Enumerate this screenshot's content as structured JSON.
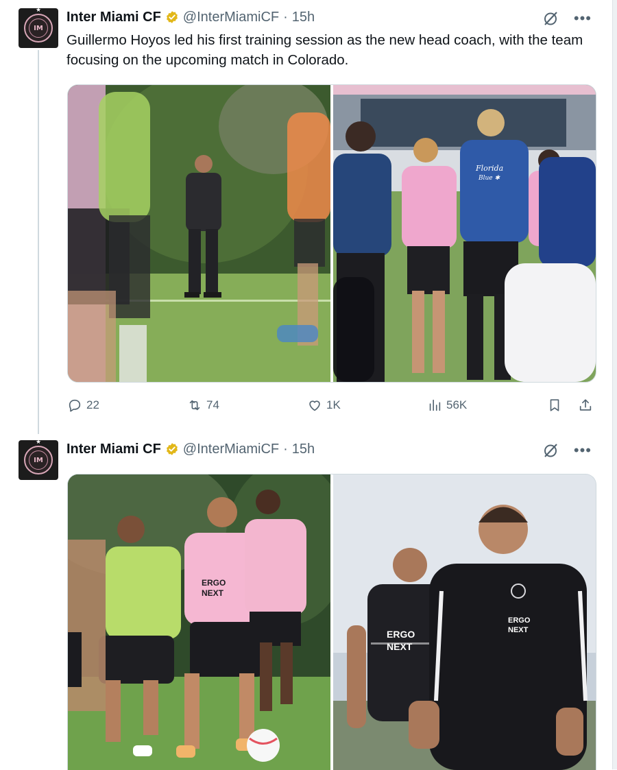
{
  "tweets": [
    {
      "author_name": "Inter Miami CF",
      "handle": "@InterMiamiCF",
      "separator": "·",
      "time": "15h",
      "text": "Guillermo Hoyos led his first training session as the new head coach, with the team focusing on the upcoming match in Colorado.",
      "photos": [
        {
          "subject": "coach-standing-on-training-field",
          "kit_text": ""
        },
        {
          "subject": "players-in-huddle-from-behind",
          "kit_text": "Florida Blue"
        }
      ],
      "stats": {
        "replies": "22",
        "reposts": "74",
        "likes": "1K",
        "views": "56K"
      }
    },
    {
      "author_name": "Inter Miami CF",
      "handle": "@InterMiamiCF",
      "separator": "·",
      "time": "15h",
      "photos": [
        {
          "subject": "players-training-with-ball",
          "kit_text": "ERGO NEXT"
        },
        {
          "subject": "coach-walking-with-player",
          "kit_text": "ERGO NEXT"
        }
      ]
    }
  ],
  "colors": {
    "verified_gold": "#e2b719",
    "text": "#0f1419",
    "secondary": "#536471",
    "border": "#cfd9de",
    "brand_pink": "#f4b6cc"
  },
  "icons": [
    "verified-badge-icon",
    "grok-icon",
    "more-icon",
    "reply-icon",
    "repost-icon",
    "like-icon",
    "views-icon",
    "bookmark-icon",
    "share-icon"
  ]
}
